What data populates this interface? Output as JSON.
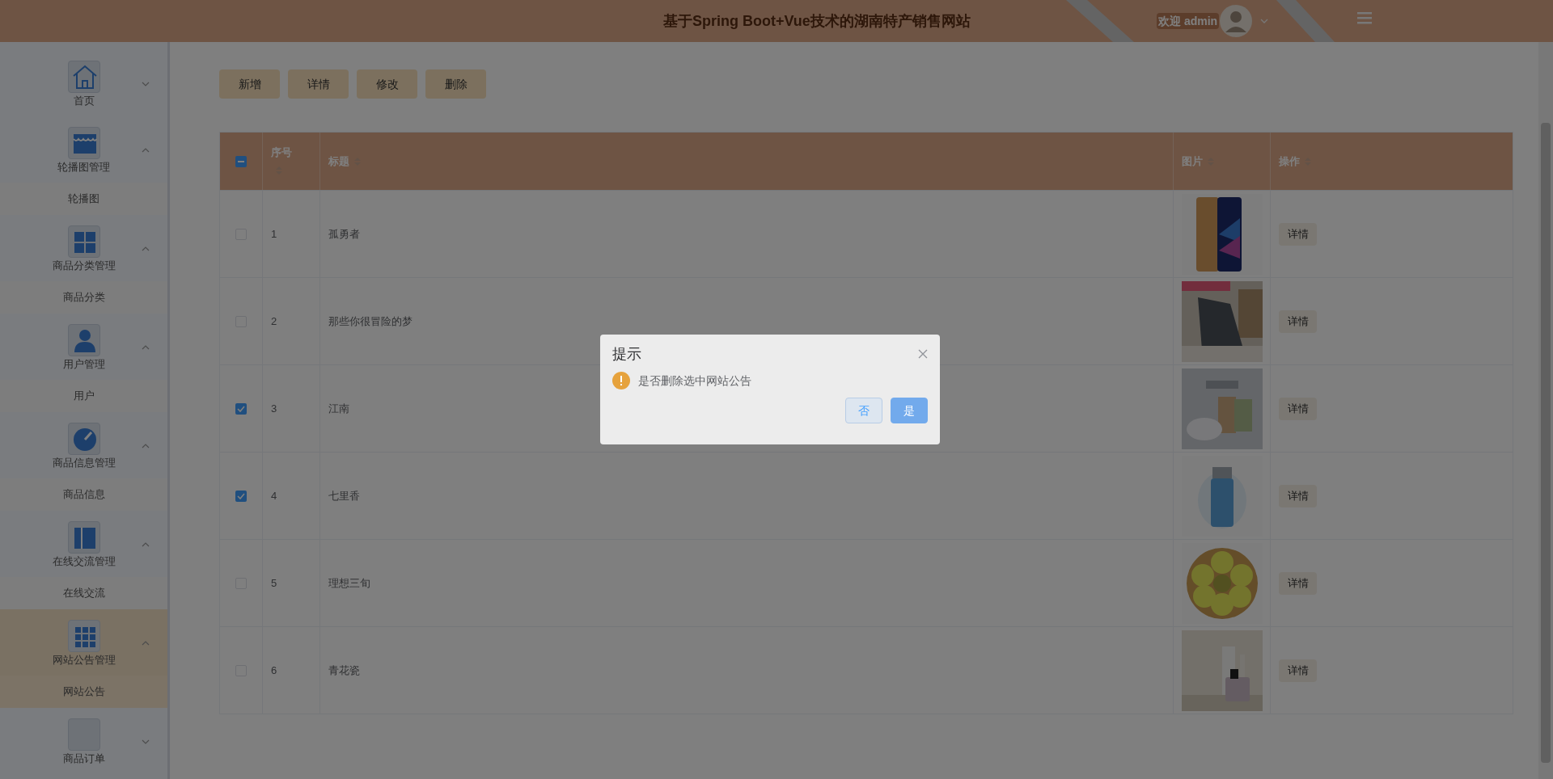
{
  "header": {
    "title": "基于Spring Boot+Vue技术的湖南特产销售网站",
    "welcome": "欢迎 admin"
  },
  "sidebar": {
    "items": [
      {
        "label": "首页",
        "expanded": false,
        "selected": false
      },
      {
        "label": "轮播图管理",
        "expanded": true,
        "selected": false,
        "children": [
          {
            "label": "轮播图",
            "selected": false
          }
        ]
      },
      {
        "label": "商品分类管理",
        "expanded": true,
        "selected": false,
        "children": [
          {
            "label": "商品分类",
            "selected": false
          }
        ]
      },
      {
        "label": "用户管理",
        "expanded": true,
        "selected": false,
        "children": [
          {
            "label": "用户",
            "selected": false
          }
        ]
      },
      {
        "label": "商品信息管理",
        "expanded": true,
        "selected": false,
        "children": [
          {
            "label": "商品信息",
            "selected": false
          }
        ]
      },
      {
        "label": "在线交流管理",
        "expanded": true,
        "selected": false,
        "children": [
          {
            "label": "在线交流",
            "selected": false
          }
        ]
      },
      {
        "label": "网站公告管理",
        "expanded": true,
        "selected": true,
        "children": [
          {
            "label": "网站公告",
            "selected": true
          }
        ]
      },
      {
        "label": "商品订单",
        "expanded": false,
        "selected": false
      }
    ]
  },
  "toolbar": {
    "buttons": [
      "新增",
      "详情",
      "修改",
      "删除"
    ]
  },
  "table": {
    "select_all_indeterminate": true,
    "columns": [
      {
        "label": "序号"
      },
      {
        "label": "标题"
      },
      {
        "label": "图片"
      },
      {
        "label": "操作"
      }
    ],
    "rows": [
      {
        "index": "1",
        "title": "孤勇者",
        "selected": false,
        "action": "详情"
      },
      {
        "index": "2",
        "title": "那些你很冒险的梦",
        "selected": false,
        "action": "详情"
      },
      {
        "index": "3",
        "title": "江南",
        "selected": true,
        "action": "详情"
      },
      {
        "index": "4",
        "title": "七里香",
        "selected": true,
        "action": "详情"
      },
      {
        "index": "5",
        "title": "理想三旬",
        "selected": false,
        "action": "详情"
      },
      {
        "index": "6",
        "title": "青花瓷",
        "selected": false,
        "action": "详情"
      }
    ]
  },
  "dialog": {
    "title": "提示",
    "message": "是否删除选中网站公告",
    "buttons": [
      {
        "label": "否",
        "primary": false
      },
      {
        "label": "是",
        "primary": true
      }
    ]
  }
}
